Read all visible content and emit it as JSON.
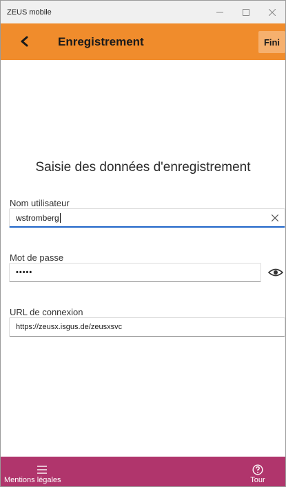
{
  "window": {
    "title": "ZEUS mobile",
    "controls": {
      "minimize": "–",
      "maximize": "☐",
      "close": "✕"
    }
  },
  "header": {
    "title": "Enregistrement",
    "finish_label": "Fini"
  },
  "form": {
    "heading": "Saisie des données d'enregistrement",
    "username": {
      "label": "Nom utilisateur",
      "value": "wstromberg"
    },
    "password": {
      "label": "Mot de passe",
      "value": "•••••"
    },
    "url": {
      "label": "URL de connexion",
      "value": "https://zeusx.isgus.de/zeusxsvc"
    }
  },
  "footer": {
    "legal_label": "Mentions légales",
    "tour_label": "Tour"
  },
  "colors": {
    "header_bg": "#f08c2c",
    "footer_bg": "#b0356c",
    "focus_accent": "#1e64c8"
  }
}
